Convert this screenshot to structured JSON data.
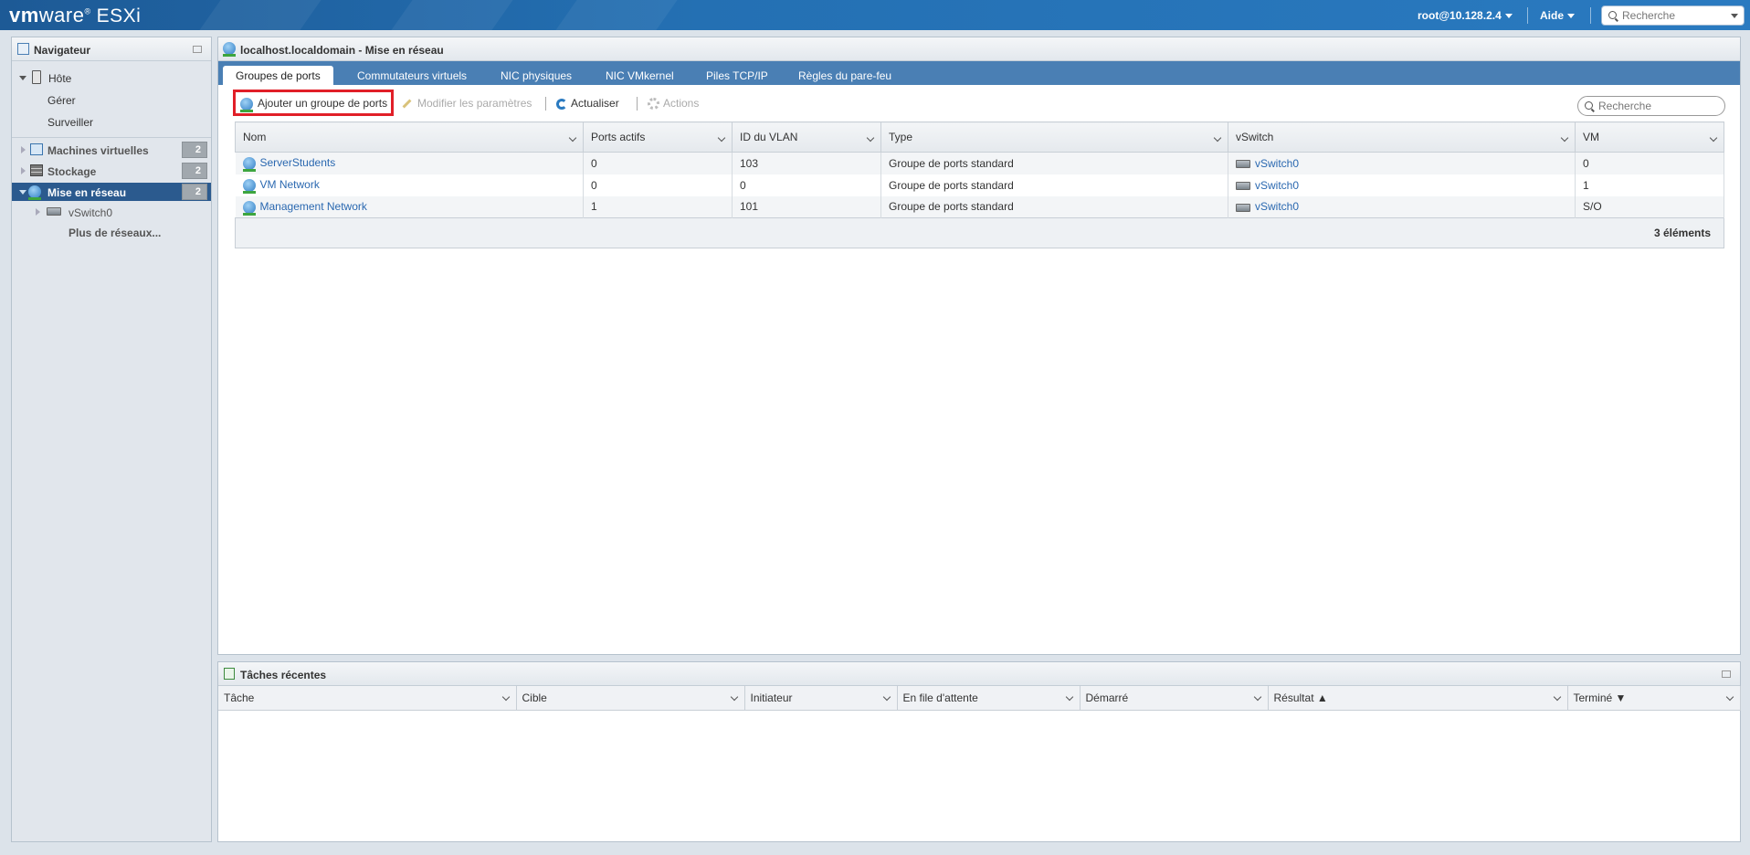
{
  "topbar": {
    "brand_vm": "vm",
    "brand_ware": "ware",
    "brand_product": "ESXi",
    "user": "root@10.128.2.4",
    "help": "Aide",
    "search_placeholder": "Recherche"
  },
  "navigator": {
    "title": "Navigateur",
    "host": {
      "label": "Hôte",
      "children": [
        "Gérer",
        "Surveiller"
      ]
    },
    "items": [
      {
        "label": "Machines virtuelles",
        "count": "2"
      },
      {
        "label": "Stockage",
        "count": "2"
      },
      {
        "label": "Mise en réseau",
        "count": "2"
      }
    ],
    "network_children": [
      "vSwitch0",
      "Plus de réseaux..."
    ]
  },
  "main": {
    "title": "localhost.localdomain - Mise en réseau",
    "tabs": [
      "Groupes de ports",
      "Commutateurs virtuels",
      "NIC physiques",
      "NIC VMkernel",
      "Piles TCP/IP",
      "Règles du pare-feu"
    ],
    "toolbar": {
      "add": "Ajouter un groupe de ports",
      "edit": "Modifier les paramètres",
      "refresh": "Actualiser",
      "actions": "Actions"
    },
    "search_placeholder": "Recherche",
    "columns": [
      "Nom",
      "Ports actifs",
      "ID du VLAN",
      "Type",
      "vSwitch",
      "VM"
    ],
    "rows": [
      {
        "name": "ServerStudents",
        "active_ports": "0",
        "vlan": "103",
        "type": "Groupe de ports standard",
        "vswitch": "vSwitch0",
        "vm": "0"
      },
      {
        "name": "VM Network",
        "active_ports": "0",
        "vlan": "0",
        "type": "Groupe de ports standard",
        "vswitch": "vSwitch0",
        "vm": "1"
      },
      {
        "name": "Management Network",
        "active_ports": "1",
        "vlan": "101",
        "type": "Groupe de ports standard",
        "vswitch": "vSwitch0",
        "vm": "S/O"
      }
    ],
    "footer": "3 éléments"
  },
  "tasks": {
    "title": "Tâches récentes",
    "columns": [
      "Tâche",
      "Cible",
      "Initiateur",
      "En file d'attente",
      "Démarré",
      "Résultat ▲",
      "Terminé ▼"
    ]
  },
  "colors": {
    "accent": "#2a68b0",
    "highlight": "#e11f28",
    "tab_bar": "#4a7fb4",
    "nav_active": "#2b5a8e"
  }
}
